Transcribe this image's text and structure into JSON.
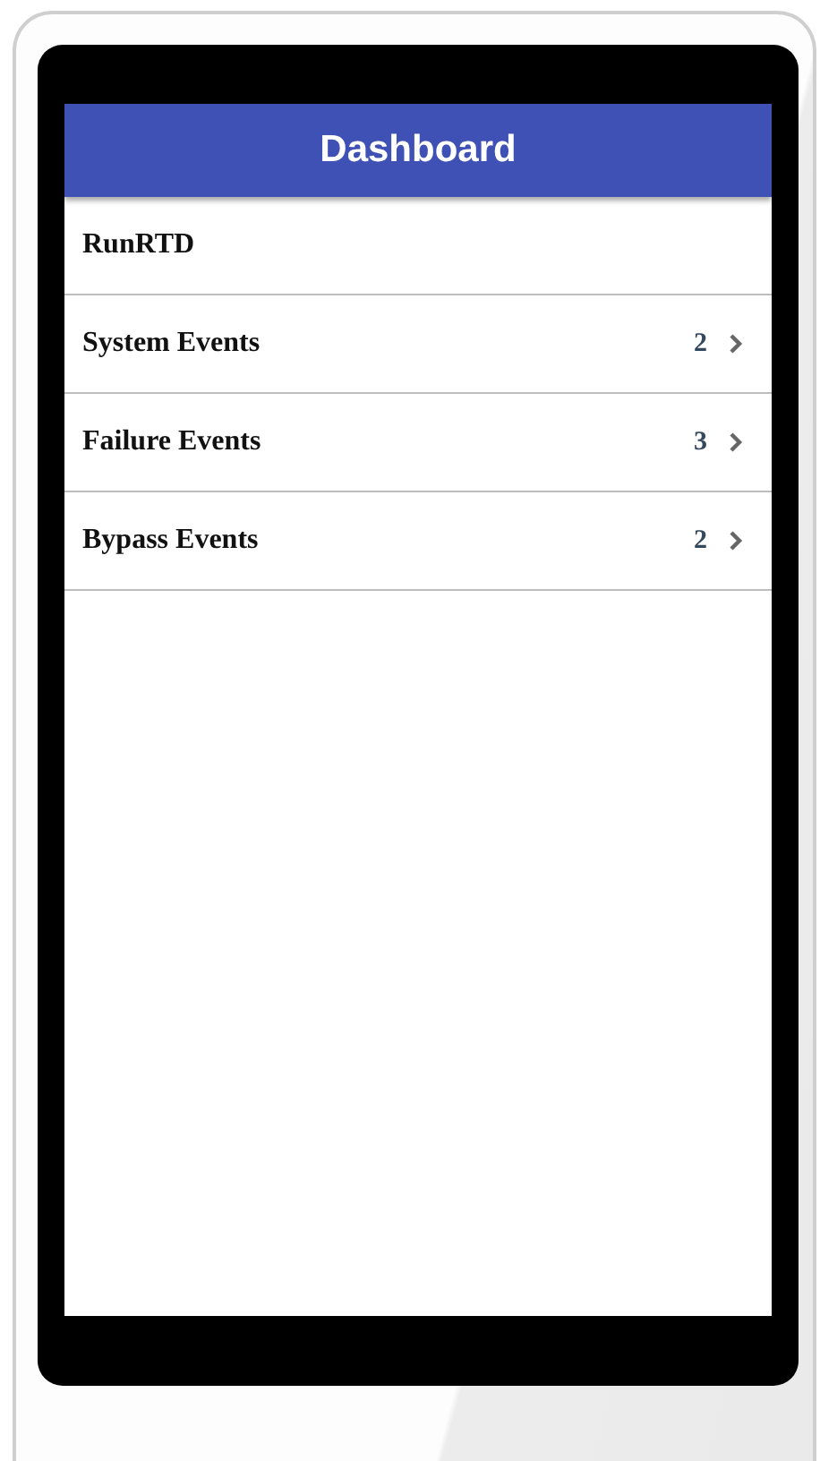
{
  "header": {
    "title": "Dashboard"
  },
  "items": [
    {
      "label": "RunRTD"
    },
    {
      "label": "System Events",
      "count": "2"
    },
    {
      "label": "Failure Events",
      "count": "3"
    },
    {
      "label": "Bypass Events",
      "count": "2"
    }
  ]
}
